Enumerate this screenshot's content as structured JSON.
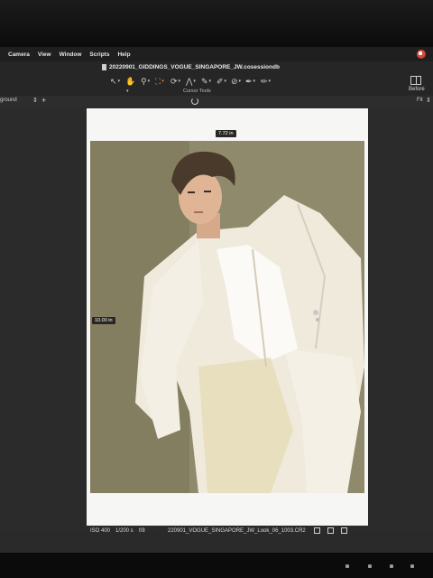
{
  "menu": {
    "items": [
      "Camera",
      "View",
      "Window",
      "Scripts",
      "Help"
    ]
  },
  "document": {
    "title": "20220901_GIDDINGS_VOGUE_SINGAPORE_JW.cosessiondb"
  },
  "toolbar": {
    "tools": [
      {
        "icon": "pointer-icon",
        "glyph": "↖"
      },
      {
        "icon": "hand-pan-icon",
        "glyph": "✋"
      },
      {
        "icon": "zoom-icon",
        "glyph": "⚲"
      },
      {
        "icon": "crop-icon",
        "glyph": "⛶"
      },
      {
        "icon": "rotate-icon",
        "glyph": "⟳"
      },
      {
        "icon": "keystone-icon",
        "glyph": "⋀"
      },
      {
        "icon": "color-picker-icon",
        "glyph": "✎"
      },
      {
        "icon": "brush-icon",
        "glyph": "✐"
      },
      {
        "icon": "gradient-icon",
        "glyph": "⊘"
      },
      {
        "icon": "eyedropper-icon",
        "glyph": "✒"
      },
      {
        "icon": "annotation-icon",
        "glyph": "✏"
      }
    ],
    "active_tool": "crop-icon",
    "cursor_tools_label": "Cursor Tools",
    "before_label": "Before"
  },
  "subbar": {
    "layer_label": "ground",
    "fit_label": "Fit"
  },
  "viewer": {
    "width_readout": "7.72 in",
    "height_readout": "10.00 in"
  },
  "status": {
    "iso": "ISO 400",
    "shutter": "1/200 s",
    "aperture": "f/8",
    "filename": "220901_VOGUE_SINGAPORE_JW_Look_06_1003.CR2"
  },
  "colors": {
    "accent": "#ff8a2a",
    "background": "#2b2b2b"
  }
}
